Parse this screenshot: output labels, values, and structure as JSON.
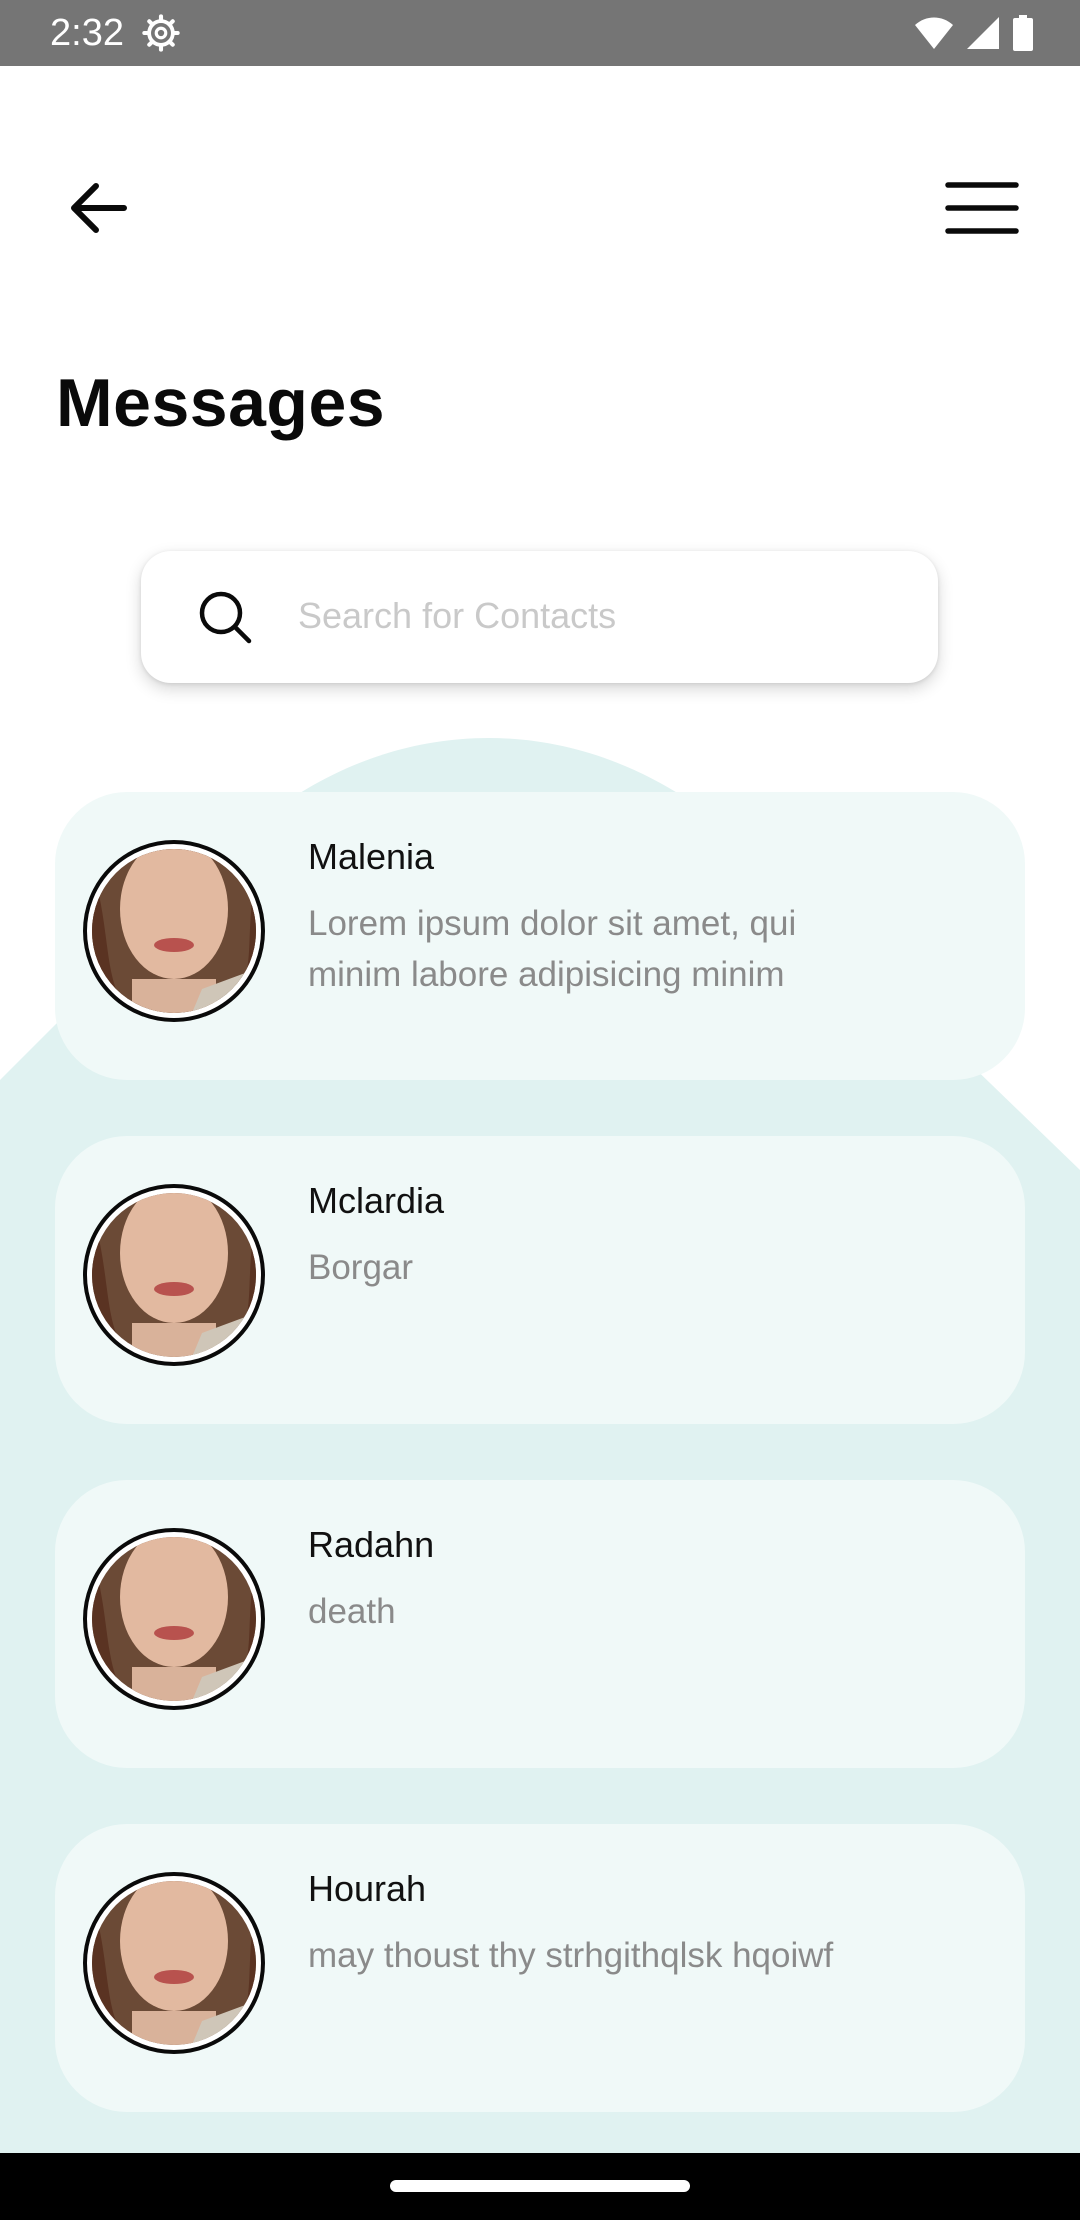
{
  "status_bar": {
    "time": "2:32"
  },
  "header": {
    "back_icon": "arrow-left-icon",
    "menu_icon": "hamburger-menu-icon",
    "title": "Messages"
  },
  "search": {
    "placeholder": "Search for Contacts",
    "value": ""
  },
  "messages": [
    {
      "name": "Malenia",
      "preview": "Lorem ipsum dolor sit amet, qui minim labore adipisicing minim"
    },
    {
      "name": "Mclardia",
      "preview": "Borgar"
    },
    {
      "name": "Radahn",
      "preview": "death"
    },
    {
      "name": "Hourah",
      "preview": "may thoust thy strhgithqlsk hqoiwf"
    }
  ],
  "colors": {
    "accent_bg": "#e0f2f1",
    "card_bg": "#f0f9f8",
    "status_bar": "#757575",
    "text_primary": "#111111",
    "text_secondary": "#8a8a8a"
  }
}
